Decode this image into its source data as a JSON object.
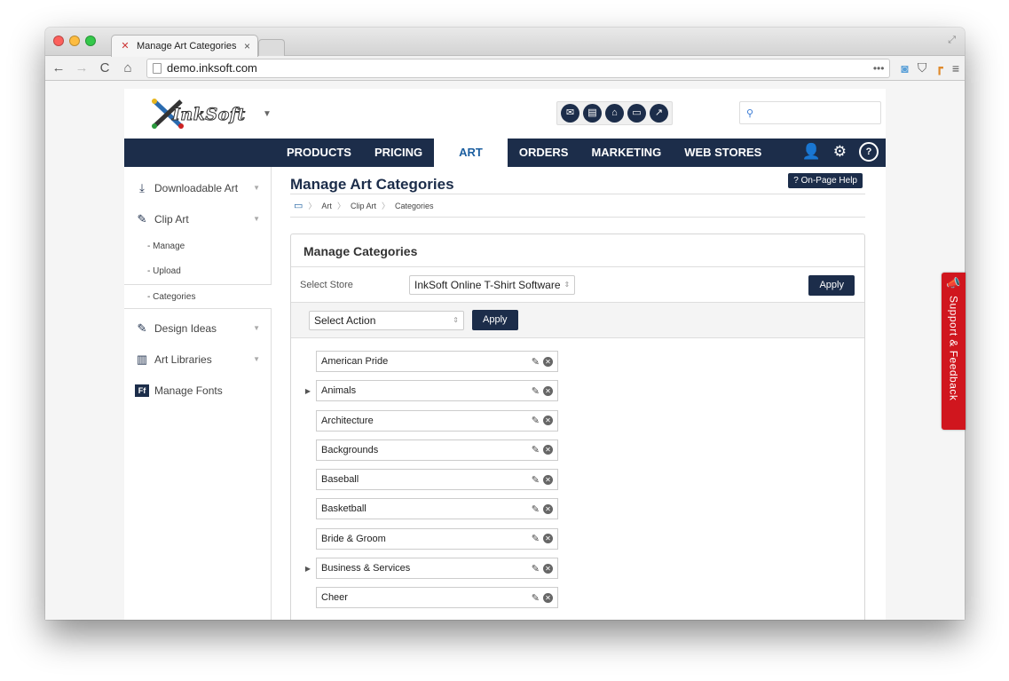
{
  "browser": {
    "tab_title": "Manage Art Categories",
    "tab_close": "×",
    "url": "demo.inksoft.com"
  },
  "header": {
    "logo_text": "InkSoft",
    "search_placeholder": ""
  },
  "main_nav": [
    "PRODUCTS",
    "PRICING",
    "ART",
    "ORDERS",
    "MARKETING",
    "WEB STORES"
  ],
  "sidebar": {
    "downloadable": "Downloadable Art",
    "clipart": "Clip Art",
    "sub": [
      "- Manage",
      "- Upload",
      "- Categories"
    ],
    "design": "Design Ideas",
    "libraries": "Art Libraries",
    "fonts": "Manage Fonts"
  },
  "content": {
    "title": "Manage Art Categories",
    "help_btn": "? On-Page Help",
    "breadcrumb": [
      "Art",
      "Clip Art",
      "Categories"
    ],
    "panel_title": "Manage Categories",
    "store_label": "Select Store",
    "store_value": "InkSoft Online T-Shirt Software",
    "apply": "Apply",
    "action_value": "Select Action",
    "categories": [
      {
        "name": "American Pride",
        "expandable": false
      },
      {
        "name": "Animals",
        "expandable": true
      },
      {
        "name": "Architecture",
        "expandable": false
      },
      {
        "name": "Backgrounds",
        "expandable": false
      },
      {
        "name": "Baseball",
        "expandable": false
      },
      {
        "name": "Basketball",
        "expandable": false
      },
      {
        "name": "Bride & Groom",
        "expandable": false
      },
      {
        "name": "Business & Services",
        "expandable": true
      },
      {
        "name": "Cheer",
        "expandable": false
      }
    ]
  },
  "support_tab": "Support & Feedback",
  "colors": {
    "navy": "#1c2d4a",
    "accent_blue": "#1c5fa0",
    "support_red": "#d0161e"
  }
}
